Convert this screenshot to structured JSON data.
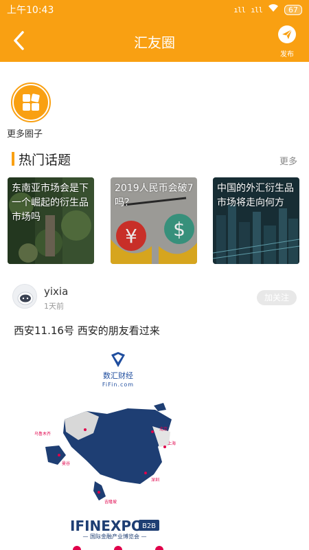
{
  "status_bar": {
    "time": "上午10:43",
    "signal": "ıll",
    "signal2": "ıll",
    "battery": "67"
  },
  "header": {
    "title": "汇友圈",
    "publish_label": "发布"
  },
  "more_circles": {
    "label": "更多圈子"
  },
  "hot_topics": {
    "title": "热门话题",
    "more_label": "更多",
    "items": [
      {
        "text": "东南亚市场会是下一个崛起的衍生品市场吗"
      },
      {
        "text": "2019人民币会破7吗？"
      },
      {
        "text": "中国的外汇衍生品市场将走向何方"
      }
    ]
  },
  "post": {
    "user_name": "yixia",
    "time": "1天前",
    "follow_label": "加关注",
    "text": "西安11.16号 西安的朋友看过来",
    "image": {
      "brand_name": "数汇财经",
      "brand_url": "FiFin.com",
      "expo_name": "IFINEXPO",
      "expo_tag": "B2B",
      "expo_subtitle": "— 国际金融产业博览会 —",
      "cities": [
        "乌鲁木齐",
        "北京",
        "上海",
        "曼谷",
        "深圳",
        "吉隆坡"
      ]
    }
  },
  "colors": {
    "accent": "#f9a012"
  }
}
